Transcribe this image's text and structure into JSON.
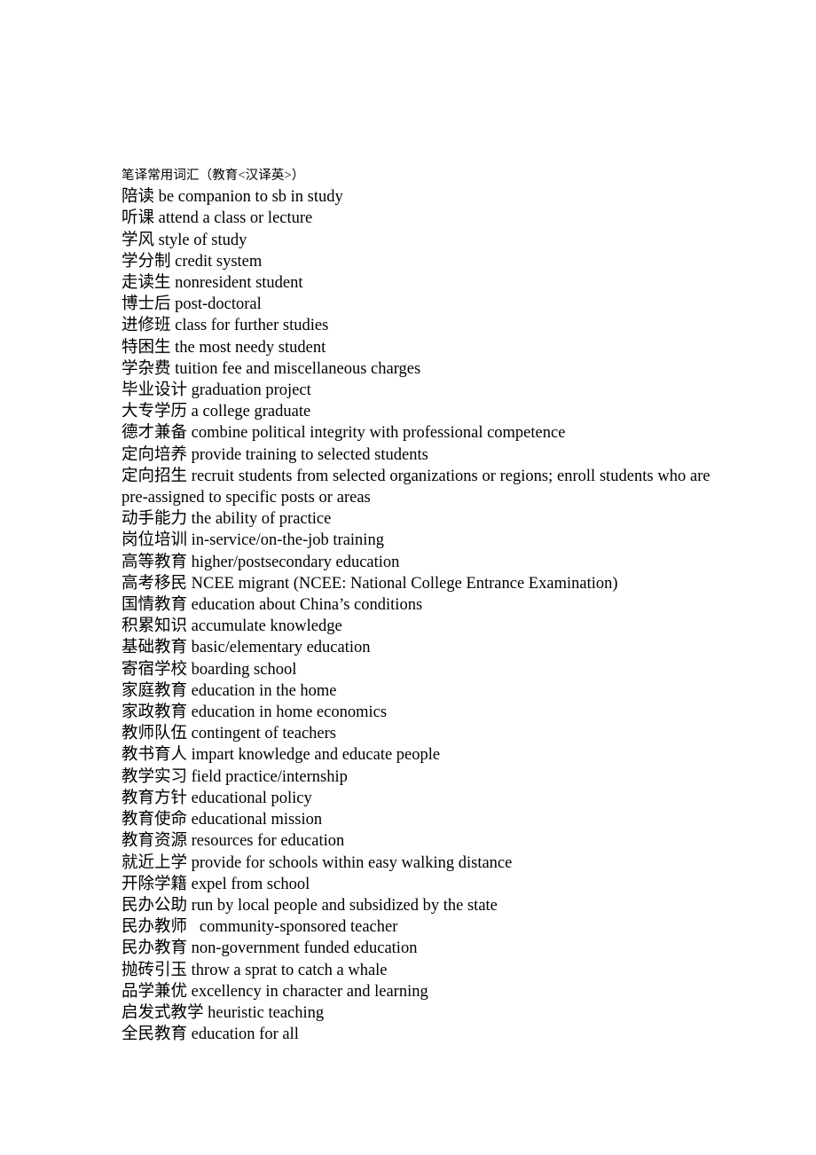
{
  "document": {
    "title": "笔译常用词汇（教育<汉译英>）",
    "background_color": "#ffffff",
    "text_color": "#000000",
    "entries": [
      {
        "term": "陪读",
        "gloss": "be companion to sb in study"
      },
      {
        "term": "听课",
        "gloss": "attend a class or lecture"
      },
      {
        "term": "学风",
        "gloss": "style of study"
      },
      {
        "term": "学分制",
        "gloss": "credit system"
      },
      {
        "term": "走读生",
        "gloss": "nonresident student"
      },
      {
        "term": "博士后",
        "gloss": "post-doctoral"
      },
      {
        "term": "进修班",
        "gloss": "class for further studies"
      },
      {
        "term": "特困生",
        "gloss": "the most needy student"
      },
      {
        "term": "学杂费",
        "gloss": "tuition fee and miscellaneous charges"
      },
      {
        "term": "毕业设计",
        "gloss": "graduation project"
      },
      {
        "term": "大专学历",
        "gloss": "a college graduate"
      },
      {
        "term": "德才兼备",
        "gloss": "combine political integrity with professional competence"
      },
      {
        "term": "定向培养",
        "gloss": "provide training to selected students"
      },
      {
        "term": "定向招生",
        "gloss": "recruit students from selected organizations or regions; enroll students who are pre-assigned to specific posts or areas"
      },
      {
        "term": "动手能力",
        "gloss": "the ability of practice"
      },
      {
        "term": "岗位培训",
        "gloss": "in-service/on-the-job training"
      },
      {
        "term": "高等教育",
        "gloss": "higher/postsecondary education"
      },
      {
        "term": "高考移民",
        "gloss": "NCEE migrant (NCEE: National College Entrance Examination)"
      },
      {
        "term": "国情教育",
        "gloss": "education about China’s conditions"
      },
      {
        "term": "积累知识",
        "gloss": "accumulate knowledge"
      },
      {
        "term": "基础教育",
        "gloss": "basic/elementary education"
      },
      {
        "term": "寄宿学校",
        "gloss": "boarding school"
      },
      {
        "term": "家庭教育",
        "gloss": "education in the home"
      },
      {
        "term": "家政教育",
        "gloss": "education in home economics"
      },
      {
        "term": "教师队伍",
        "gloss": "contingent of teachers"
      },
      {
        "term": "教书育人",
        "gloss": "impart knowledge and educate people"
      },
      {
        "term": "教学实习",
        "gloss": "field practice/internship"
      },
      {
        "term": "教育方针",
        "gloss": "educational policy"
      },
      {
        "term": "教育使命",
        "gloss": "educational mission"
      },
      {
        "term": "教育资源",
        "gloss": "resources for education"
      },
      {
        "term": "就近上学",
        "gloss": "provide for schools within easy walking distance"
      },
      {
        "term": "开除学籍",
        "gloss": "expel from school"
      },
      {
        "term": "民办公助",
        "gloss": "run by local people and subsidized by the state"
      },
      {
        "term": "民办教师",
        "gloss": "  community-sponsored teacher"
      },
      {
        "term": "民办教育",
        "gloss": "non-government funded education"
      },
      {
        "term": "抛砖引玉",
        "gloss": "throw a sprat to catch a whale"
      },
      {
        "term": "品学兼优",
        "gloss": "excellency in character and learning"
      },
      {
        "term": "启发式教学",
        "gloss": "heuristic teaching"
      },
      {
        "term": "全民教育",
        "gloss": "education for all"
      }
    ]
  }
}
